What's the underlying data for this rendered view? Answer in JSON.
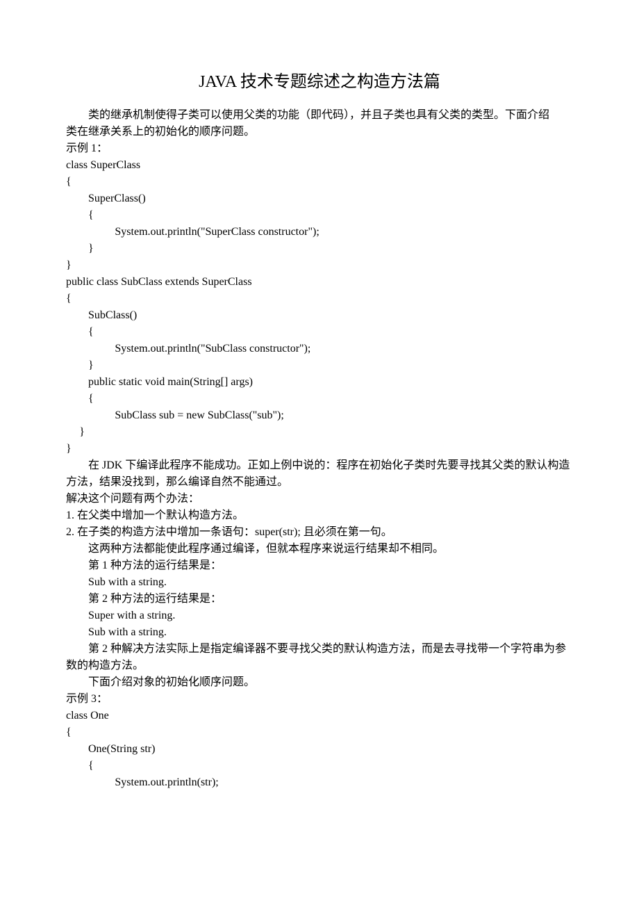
{
  "title": "JAVA 技术专题综述之构造方法篇",
  "p1": "类的继承机制使得子类可以使用父类的功能（即代码），并且子类也具有父类的类型。下面介绍",
  "p2": "类在继承关系上的初始化的顺序问题。",
  "p3": "示例 1：",
  "code1": {
    "l1": "class SuperClass",
    "l2": "{",
    "l3": "SuperClass()",
    "l4": "{",
    "l5": "System.out.println(\"SuperClass constructor\");",
    "l6": "}",
    "l7": "}",
    "l8": "public class SubClass extends SuperClass",
    "l9": "{",
    "l10": "SubClass()",
    "l11": "{",
    "l12": "System.out.println(\"SubClass constructor\");",
    "l13": "}",
    "l14": "public static void main(String[] args)",
    "l15": "{",
    "l16": "SubClass sub = new SubClass(\"sub\");",
    "l17": "}",
    "l18": "}"
  },
  "p4": "在 JDK 下编译此程序不能成功。正如上例中说的：程序在初始化子类时先要寻找其父类的默认构造方法，结果没找到，那么编译自然不能通过。",
  "p5": "解决这个问题有两个办法：",
  "li1": "1.    在父类中增加一个默认构造方法。",
  "li2": "2.    在子类的构造方法中增加一条语句：super(str);  且必须在第一句。",
  "p6": "这两种方法都能使此程序通过编译，但就本程序来说运行结果却不相同。",
  "p7": "第 1 种方法的运行结果是：",
  "p8": "Sub with a string.",
  "p9": "第 2 种方法的运行结果是：",
  "p10": "Super with a string.",
  "p11": "Sub with a string.",
  "p12": "第 2 种解决方法实际上是指定编译器不要寻找父类的默认构造方法，而是去寻找带一个字符串为参数的构造方法。",
  "p13": "下面介绍对象的初始化顺序问题。",
  "p14": "示例 3：",
  "code2": {
    "l1": "class One",
    "l2": "{",
    "l3": "One(String str)",
    "l4": "{",
    "l5": "System.out.println(str);"
  }
}
